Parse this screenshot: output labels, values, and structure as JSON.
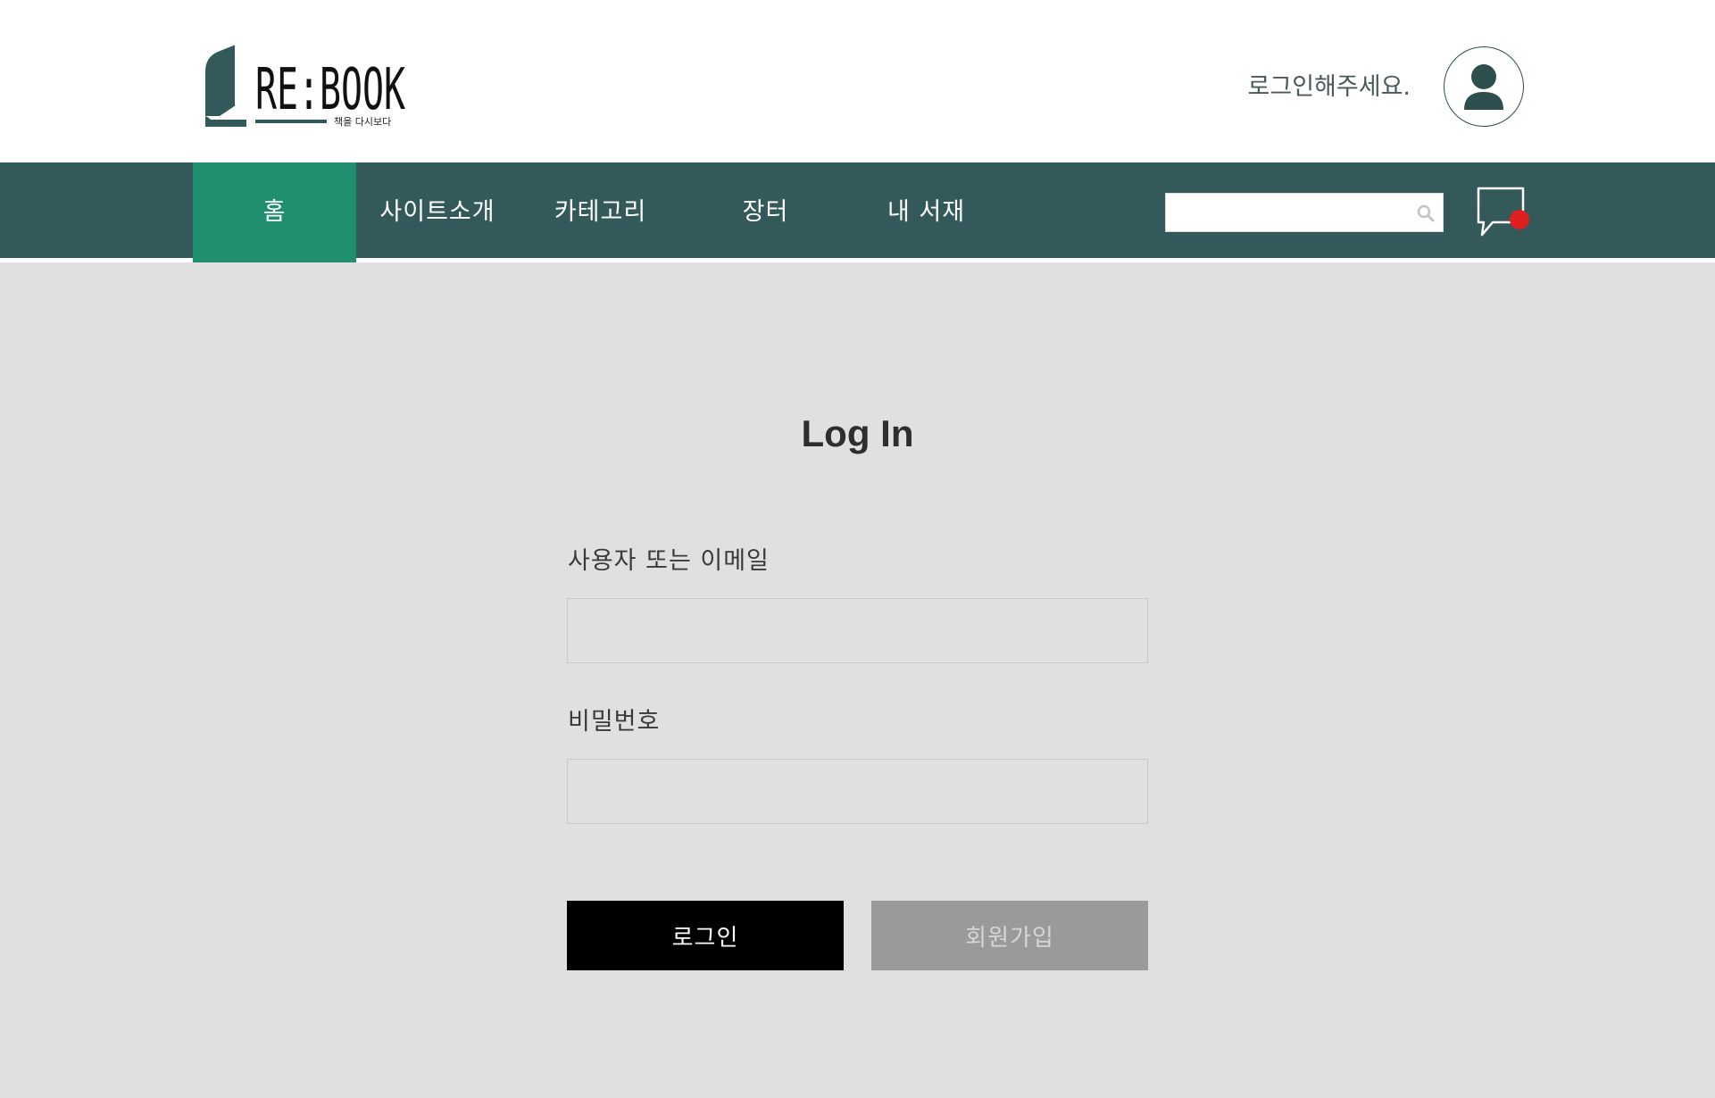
{
  "header": {
    "logo_text": "RE:BOOK",
    "logo_tagline": "책을 다시보다",
    "login_prompt": "로그인해주세요."
  },
  "nav": {
    "items": [
      {
        "label": "홈",
        "active": true
      },
      {
        "label": "사이트소개",
        "active": false
      },
      {
        "label": "카테고리",
        "active": false
      },
      {
        "label": "장터",
        "active": false
      },
      {
        "label": "내 서재",
        "active": false
      }
    ],
    "search": {
      "value": "",
      "placeholder": ""
    },
    "chat": {
      "icon": "chat-bubble-icon",
      "has_notification": true
    }
  },
  "login_form": {
    "title": "Log In",
    "username_label": "사용자 또는 이메일",
    "username_value": "",
    "password_label": "비밀번호",
    "password_value": "",
    "login_button": "로그인",
    "signup_button": "회원가입"
  },
  "colors": {
    "nav_bg": "#34595a",
    "nav_active": "#1f8f70",
    "page_bg": "#e0e0e0",
    "notification": "#e02020",
    "brand_dark": "#2f4f4f"
  }
}
